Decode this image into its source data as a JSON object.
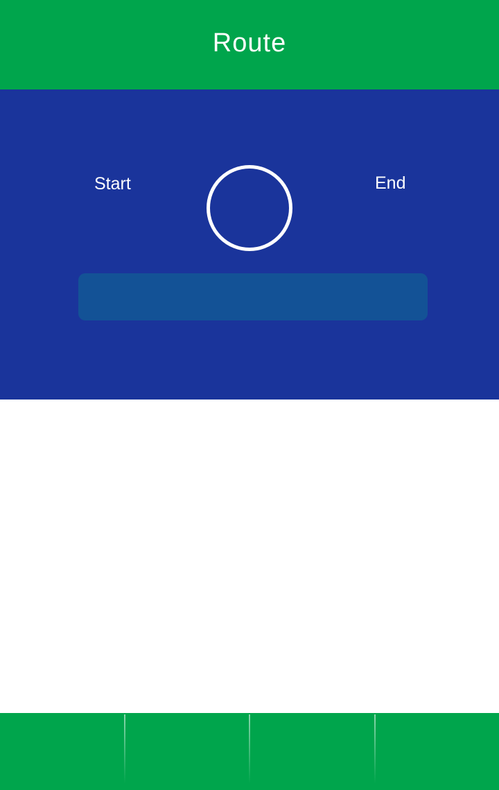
{
  "header": {
    "title": "Route"
  },
  "route": {
    "start_label": "Start",
    "end_label": "End"
  },
  "colors": {
    "header_green": "#00a54c",
    "panel_blue": "#1a349b",
    "route_box_blue": "#135296",
    "white": "#ffffff"
  },
  "bottom_nav": {
    "items": [
      "",
      "",
      "",
      ""
    ]
  }
}
